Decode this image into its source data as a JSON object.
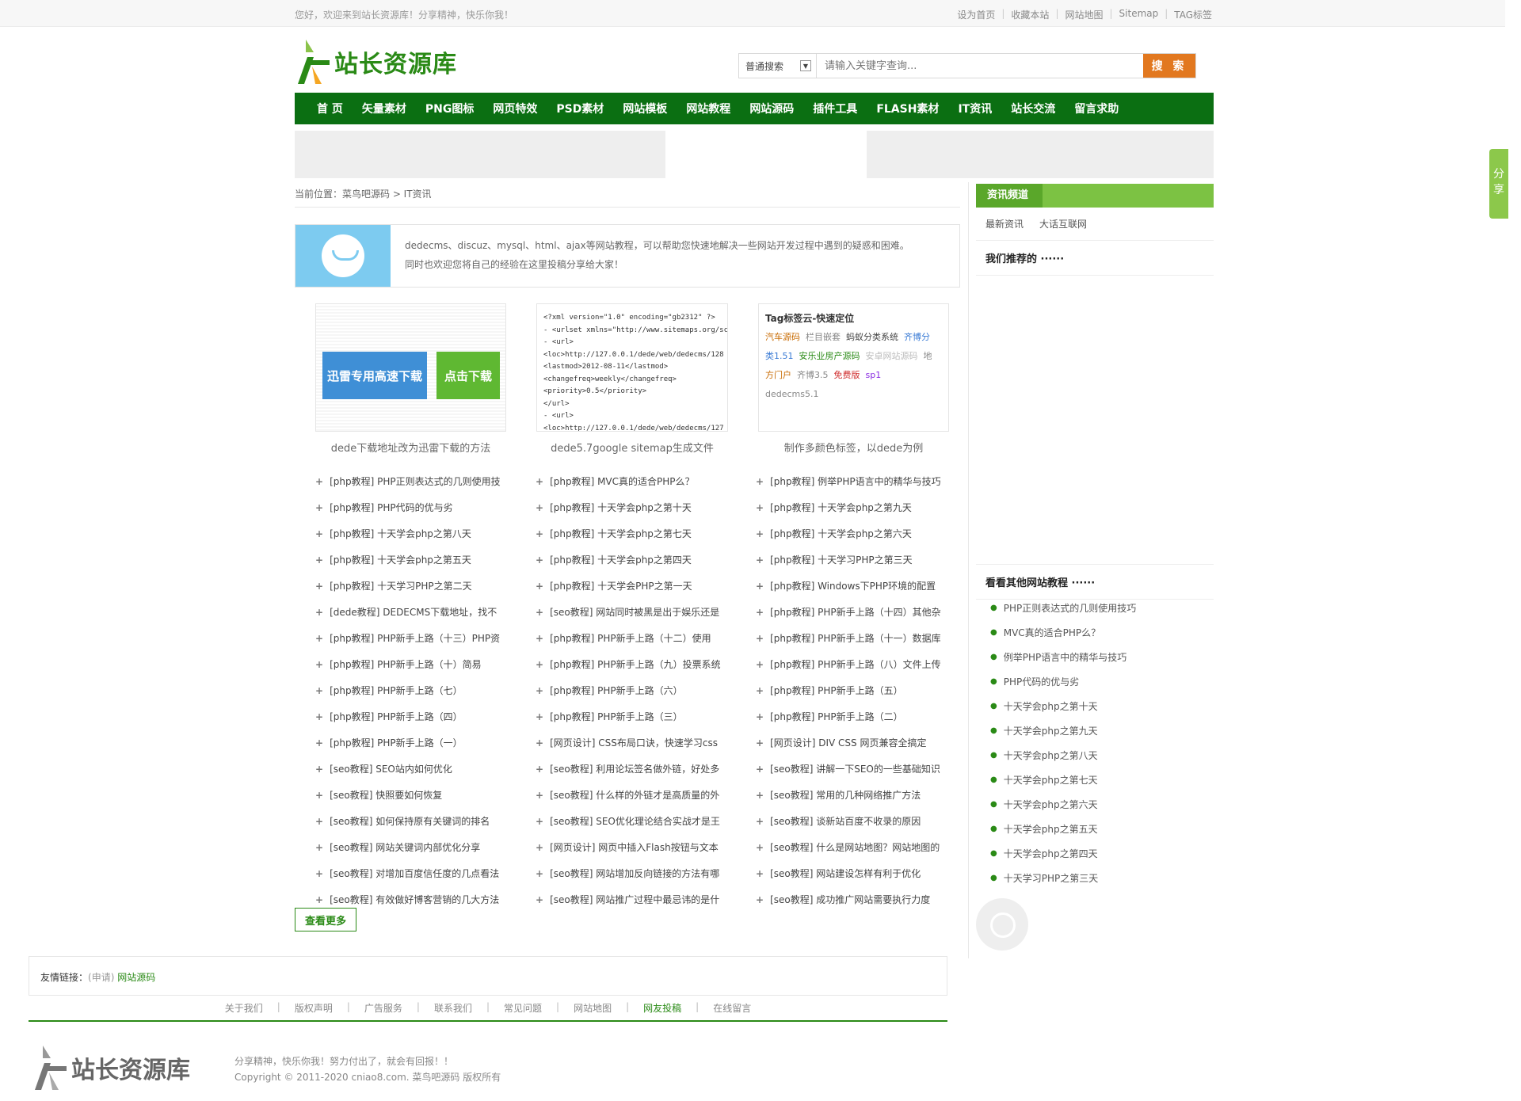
{
  "topbar": {
    "welcome": "您好，欢迎来到站长资源库！分享精神，快乐你我！",
    "links": [
      "设为首页",
      "收藏本站",
      "网站地图",
      "Sitemap",
      "TAG标签"
    ]
  },
  "logo": {
    "text": "站长资源库"
  },
  "search": {
    "type": "普通搜索",
    "placeholder": "请输入关键字查询...",
    "button": "搜 索"
  },
  "nav": [
    "首 页",
    "矢量素材",
    "PNG图标",
    "网页特效",
    "PSD素材",
    "网站模板",
    "网站教程",
    "网站源码",
    "插件工具",
    "FLASH素材",
    "IT资讯",
    "站长交流",
    "留言求助"
  ],
  "breadcrumb": "当前位置：菜鸟吧源码 > IT资讯",
  "intro": {
    "line1": "dedecms、discuz、mysql、html、ajax等网站教程，可以帮助您快速地解决一些网站开发过程中遇到的疑惑和困难。",
    "line2": "同时也欢迎您将自己的经验在这里投稿分享给大家！"
  },
  "thumbs": [
    {
      "caption": "dede下载地址改为迅雷下载的方法",
      "btn1": "迅雷专用高速下载",
      "btn2": "点击下载"
    },
    {
      "caption": "dede5.7google sitemap生成文件",
      "xml": [
        "<?xml version=\"1.0\" encoding=\"gb2312\" ?>",
        "- <urlset xmlns=\"http://www.sitemaps.org/schemas/s",
        "  - <url>",
        "      <loc>http://127.0.0.1/dede/web/dedecms/128",
        "      <lastmod>2012-08-11</lastmod>",
        "      <changefreq>weekly</changefreq>",
        "      <priority>0.5</priority>",
        "    </url>",
        "  - <url>",
        "      <loc>http://127.0.0.1/dede/web/dedecms/127"
      ]
    },
    {
      "caption": "制作多颜色标签，以dede为例",
      "title": "Tag标签云-快速定位",
      "tags": [
        [
          "汽车源码",
          "栏目嵌套",
          "蚂蚁分类系统",
          "齐博分"
        ],
        [
          "类1.51",
          "安乐业房产源码",
          "安卓网站源码",
          "地"
        ],
        [
          "方门户",
          "齐博3.5",
          "免费版",
          "sp1"
        ],
        [
          "dedecms5.1"
        ]
      ]
    }
  ],
  "list": [
    "[php教程] PHP正则表达式的几则使用技",
    "[php教程] MVC真的适合PHP么？",
    "[php教程] 例举PHP语言中的精华与技巧",
    "[php教程] PHP代码的优与劣",
    "[php教程] 十天学会php之第十天",
    "[php教程] 十天学会php之第九天",
    "[php教程] 十天学会php之第八天",
    "[php教程] 十天学会php之第七天",
    "[php教程] 十天学会php之第六天",
    "[php教程] 十天学会php之第五天",
    "[php教程] 十天学会php之第四天",
    "[php教程] 十天学习PHP之第三天",
    "[php教程] 十天学习PHP之第二天",
    "[php教程] 十天学会PHP之第一天",
    "[php教程] Windows下PHP环境的配置",
    "[dede教程] DEDECMS下载地址，找不",
    "[seo教程] 网站同时被黑是出于娱乐还是",
    "[php教程] PHP新手上路（十四）其他杂",
    "[php教程] PHP新手上路（十三）PHP资",
    "[php教程] PHP新手上路（十二）使用",
    "[php教程] PHP新手上路（十一）数据库",
    "[php教程] PHP新手上路（十）简易",
    "[php教程] PHP新手上路（九）投票系统",
    "[php教程] PHP新手上路（八）文件上传",
    "[php教程] PHP新手上路（七）",
    "[php教程] PHP新手上路（六）",
    "[php教程] PHP新手上路（五）",
    "[php教程] PHP新手上路（四）",
    "[php教程] PHP新手上路（三）",
    "[php教程] PHP新手上路（二）",
    "[php教程] PHP新手上路（一）",
    "[网页设计] CSS布局口诀，快速学习css",
    "[网页设计] DIV CSS 网页兼容全搞定",
    "[seo教程] SEO站内如何优化",
    "[seo教程] 利用论坛签名做外链，好处多",
    "[seo教程] 讲解一下SEO的一些基础知识",
    "[seo教程] 快照要如何恢复",
    "[seo教程] 什么样的外链才是高质量的外",
    "[seo教程] 常用的几种网络推广方法",
    "[seo教程] 如何保持原有关键词的排名",
    "[seo教程] SEO优化理论结合实战才是王",
    "[seo教程] 谈新站百度不收录的原因",
    "[seo教程] 网站关键词内部优化分享",
    "[网页设计] 网页中插入Flash按钮与文本",
    "[seo教程] 什么是网站地图？网站地图的",
    "[seo教程] 对增加百度信任度的几点看法",
    "[seo教程] 网站增加反向链接的方法有哪",
    "[seo教程] 网站建设怎样有利于优化",
    "[seo教程] 有效做好博客营销的几大方法",
    "[seo教程] 网站推广过程中最忌讳的是什",
    "[seo教程] 成功推广网站需要执行力度"
  ],
  "more_button": "查看更多",
  "sidebar": {
    "channel": "资讯频道",
    "sub": [
      "最新资讯",
      "大话互联网"
    ],
    "recommend": "我们推荐的 ······",
    "other": "看看其他网站教程 ······",
    "items": [
      "PHP正则表达式的几则使用技巧",
      "MVC真的适合PHP么？",
      "例举PHP语言中的精华与技巧",
      "PHP代码的优与劣",
      "十天学会php之第十天",
      "十天学会php之第九天",
      "十天学会php之第八天",
      "十天学会php之第七天",
      "十天学会php之第六天",
      "十天学会php之第五天",
      "十天学会php之第四天",
      "十天学习PHP之第三天"
    ]
  },
  "share": "分享",
  "friends": {
    "label": "友情链接：",
    "apply": "(申请)",
    "link": "网站源码"
  },
  "footer_links": [
    "关于我们",
    "版权声明",
    "广告服务",
    "联系我们",
    "常见问题",
    "网站地图",
    "网友投稿",
    "在线留言"
  ],
  "footer": {
    "logo": "站长资源库",
    "slogan": "分享精神，快乐你我！努力付出了，就会有回报！！",
    "copyright": "Copyright © 2011-2020 cniao8.com. 菜鸟吧源码 版权所有"
  },
  "colors": {
    "nav": "#0b6f12",
    "accent": "#2a8a16",
    "search_button": "#e2781f",
    "sidebar_head": "#7cc243"
  }
}
